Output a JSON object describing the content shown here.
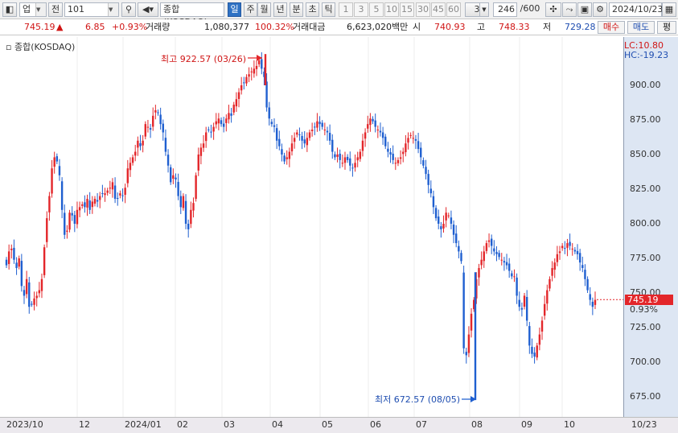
{
  "toolbar": {
    "market_type": "업",
    "jeon_label": "전",
    "code": "101",
    "index_name": "종합(KOSDAQ)",
    "periods": [
      "일",
      "주",
      "월",
      "년",
      "분",
      "초",
      "틱"
    ],
    "active_period": "일",
    "intervals": [
      "1",
      "3",
      "5",
      "10",
      "15",
      "30",
      "45",
      "60"
    ],
    "interval_select": "3",
    "count": "246",
    "total": "/600",
    "date": "2024/10/23"
  },
  "quote": {
    "price": "745.19",
    "arrow": "▲",
    "change": "6.85",
    "change_pct": "+0.93%",
    "volume_label": "거래량",
    "volume": "1,080,377",
    "volume_pct": "100.32%",
    "amount_label": "거래대금",
    "amount": "6,623,020백만",
    "open_label": "시",
    "open": "740.93",
    "high_label": "고",
    "high": "748.33",
    "low_label": "저",
    "low": "729.28",
    "buy_label": "매수",
    "sell_label": "매도",
    "eval_label": "평"
  },
  "chart_meta": {
    "title": "종합(KOSDAQ)",
    "lc": "LC:10.80",
    "hc": "HC:-19.23",
    "high_annotation": "최고 922.57 (03/26)",
    "low_annotation": "최저 672.57 (08/05)",
    "last_price": "745.19",
    "last_pct": "0.93%",
    "up_color": "#e3262a",
    "down_color": "#1f5fd0"
  },
  "chart_data": {
    "type": "candlestick",
    "title": "종합(KOSDAQ)",
    "x_start": "2023/10",
    "x_end": "10/23",
    "x_ticks": [
      "2023/10",
      "12",
      "2024/01",
      "02",
      "03",
      "04",
      "05",
      "06",
      "07",
      "08",
      "09",
      "10",
      "10/23"
    ],
    "y_ticks": [
      "675.00",
      "700.00",
      "725.00",
      "750.00",
      "775.00",
      "800.00",
      "825.00",
      "850.00",
      "875.00",
      "900.00"
    ],
    "ylim": [
      662,
      937
    ],
    "series": [
      {
        "name": "종합(KOSDAQ)",
        "close": [
          770,
          780,
          782,
          774,
          768,
          775,
          755,
          748,
          760,
          740,
          742,
          746,
          748,
          752,
          760,
          783,
          804,
          820,
          840,
          848,
          845,
          835,
          810,
          792,
          795,
          808,
          806,
          800,
          810,
          812,
          814,
          812,
          818,
          810,
          816,
          818,
          816,
          820,
          822,
          822,
          824,
          826,
          830,
          818,
          818,
          822,
          820,
          826,
          840,
          844,
          848,
          852,
          860,
          856,
          860,
          872,
          870,
          868,
          878,
          882,
          880,
          872,
          866,
          852,
          842,
          830,
          835,
          832,
          820,
          812,
          820,
          800,
          796,
          810,
          815,
          835,
          850,
          855,
          858,
          866,
          868,
          866,
          870,
          874,
          876,
          872,
          870,
          876,
          880,
          878,
          886,
          890,
          895,
          900,
          902,
          906,
          908,
          910,
          912,
          914,
          918,
          912,
          906,
          884,
          876,
          872,
          870,
          860,
          856,
          850,
          845,
          848,
          852,
          858,
          862,
          866,
          864,
          860,
          858,
          862,
          866,
          868,
          870,
          874,
          872,
          870,
          868,
          866,
          860,
          852,
          848,
          850,
          846,
          844,
          848,
          846,
          842,
          840,
          844,
          848,
          852,
          860,
          866,
          872,
          876,
          874,
          870,
          868,
          866,
          862,
          856,
          852,
          850,
          846,
          844,
          846,
          848,
          852,
          858,
          862,
          864,
          862,
          860,
          854,
          848,
          842,
          836,
          828,
          822,
          812,
          804,
          800,
          796,
          800,
          808,
          806,
          800,
          792,
          786,
          780,
          773,
          710,
          705,
          720,
          735,
          745,
          760,
          768,
          774,
          780,
          786,
          788,
          784,
          780,
          778,
          776,
          774,
          772,
          770,
          766,
          762,
          762,
          748,
          740,
          738,
          748,
          730,
          712,
          706,
          704,
          712,
          720,
          730,
          742,
          752,
          760,
          768,
          772,
          778,
          780,
          784,
          782,
          786,
          784,
          782,
          780,
          778,
          772,
          768,
          760,
          752,
          745,
          740,
          745
        ]
      }
    ],
    "high": {
      "value": 922.57,
      "date": "03/26"
    },
    "low": {
      "value": 672.57,
      "date": "08/05"
    },
    "last": 745.19,
    "grid": false,
    "legend": "none"
  }
}
